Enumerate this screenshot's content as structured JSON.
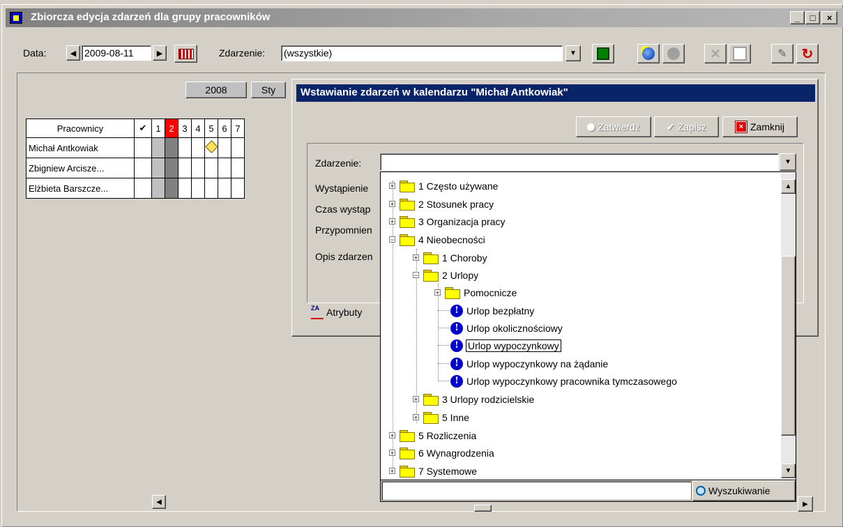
{
  "window": {
    "title": "Zbiorcza edycja zdarzeń dla grupy pracowników",
    "min": "_",
    "max": "□",
    "close": "×"
  },
  "toolbar": {
    "date_label": "Data:",
    "date_value": "2009-08-11",
    "event_label": "Zdarzenie:",
    "event_value": "(wszystkie)"
  },
  "calendar": {
    "year_label": "2008",
    "month_label": "Sty",
    "columns": {
      "employees": "Pracownicy",
      "check": "✔",
      "days": [
        "1",
        "2",
        "3",
        "4",
        "5",
        "6",
        "7"
      ]
    },
    "employees": [
      "Michał Antkowiak",
      "Zbigniew Arcisze...",
      "Elżbieta Barszcze..."
    ]
  },
  "dialog": {
    "title": "Wstawianie zdarzeń w kalendarzu \"Michał Antkowiak\"",
    "buttons": {
      "approve": "Zatwierdź",
      "save": "Zapisz",
      "close": "Zamknij"
    },
    "fields": {
      "event": "Zdarzenie:",
      "occurrence": "Wystąpienie",
      "time": "Czas wystąp",
      "reminder": "Przypomnien",
      "description": "Opis zdarzen"
    },
    "tab_attributes": "Atrybuty"
  },
  "tree": {
    "items": [
      "1 Często używane",
      "2 Stosunek pracy",
      "3 Organizacja pracy",
      "4 Nieobecności",
      "1 Choroby",
      "2 Urlopy",
      "Pomocnicze",
      "Urlop bezpłatny",
      "Urlop okolicznościowy",
      "Urlop wypoczynkowy",
      "Urlop wypoczynkowy na żądanie",
      "Urlop wypoczynkowy pracownika tymczasowego",
      "3 Urlopy rodzicielskie",
      "5 Inne",
      "5 Rozliczenia",
      "6 Wynagrodzenia",
      "7 Systemowe"
    ],
    "selected": "Urlop wypoczynkowy",
    "search_value": "",
    "search_button": "Wyszukiwanie"
  },
  "colors": {
    "dialog_title": "#0a246a",
    "today": "#ff0000",
    "folder": "#ffff00",
    "info_icon": "#0000c8"
  },
  "icons": [
    "window-icon",
    "arrow-left-icon",
    "arrow-right-icon",
    "calendar-icon",
    "dropdown-icon",
    "filter-icon",
    "add-event-icon",
    "edit-event-icon",
    "delete-icon",
    "copy-icon",
    "print-icon",
    "refresh-icon",
    "tag-icon",
    "attributes-icon",
    "search-icon",
    "folder-icon",
    "info-icon",
    "expand-icon",
    "collapse-icon"
  ]
}
